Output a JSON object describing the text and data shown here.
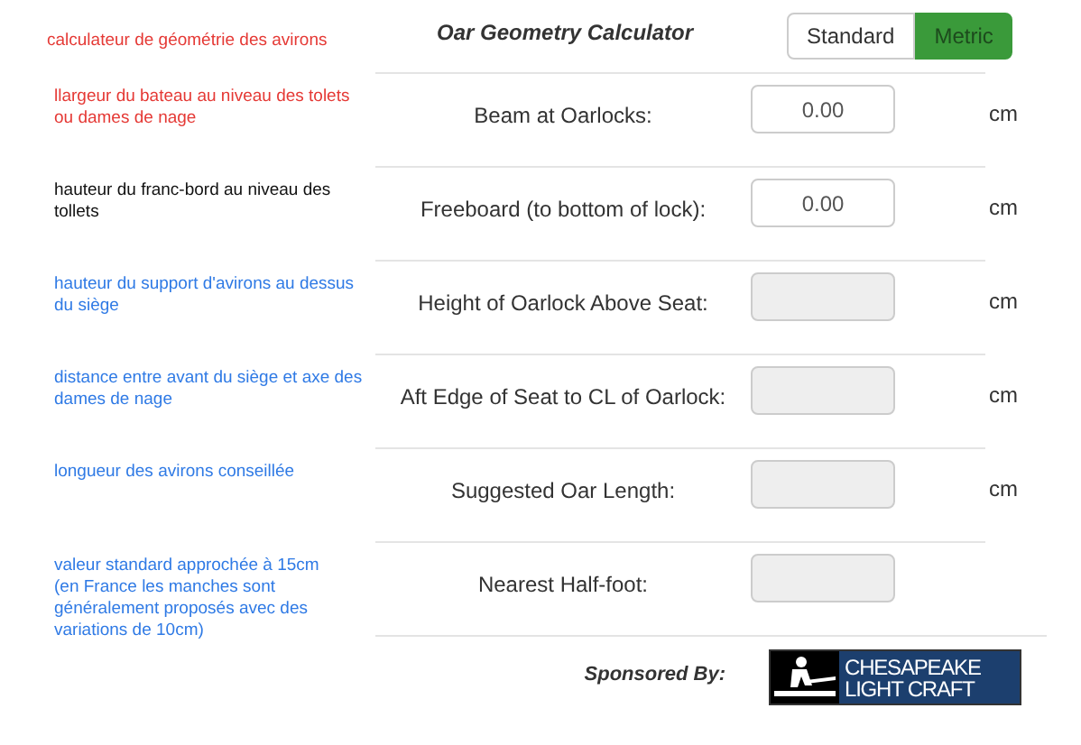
{
  "header": {
    "note": {
      "text": "calculateur de géométrie des avirons",
      "color": "#e53935"
    },
    "title": "Oar Geometry Calculator",
    "units": [
      {
        "label": "Standard",
        "selected": false
      },
      {
        "label": "Metric",
        "selected": true
      }
    ]
  },
  "rows": [
    {
      "note": {
        "text": "llargeur du bateau au niveau des tolets ou dames de nage",
        "color": "#e53935"
      },
      "label": "Beam at Oarlocks:",
      "value": "0.00",
      "disabled": false,
      "unit": "cm"
    },
    {
      "note": {
        "text": "hauteur du franc-bord au niveau des tollets",
        "color": "#111111"
      },
      "label": "Freeboard (to bottom of lock):",
      "value": "0.00",
      "disabled": false,
      "unit": "cm"
    },
    {
      "note": {
        "text": "hauteur du support d'avirons au dessus du siège",
        "color": "#2f7ae5"
      },
      "label": "Height of Oarlock Above Seat:",
      "disabled": true,
      "unit": "cm"
    },
    {
      "note": {
        "text": "distance entre avant du siège et axe des dames de nage",
        "color": "#2f7ae5"
      },
      "label": "Aft Edge of Seat to CL of Oarlock:",
      "disabled": true,
      "unit": "cm"
    },
    {
      "note": {
        "text": "longueur des avirons conseillée",
        "color": "#2f7ae5"
      },
      "label": "Suggested Oar Length:",
      "disabled": true,
      "unit": "cm"
    },
    {
      "note": {
        "text": "valeur standard approchée à 15cm\n(en France les manches sont généralement proposés avec des variations de 10cm)",
        "color": "#2f7ae5"
      },
      "label": "Nearest Half-foot:",
      "disabled": true
    }
  ],
  "footer": {
    "label": "Sponsored By:",
    "logo_lines": [
      "CHESAPEAKE",
      "LIGHT CRAFT"
    ]
  }
}
